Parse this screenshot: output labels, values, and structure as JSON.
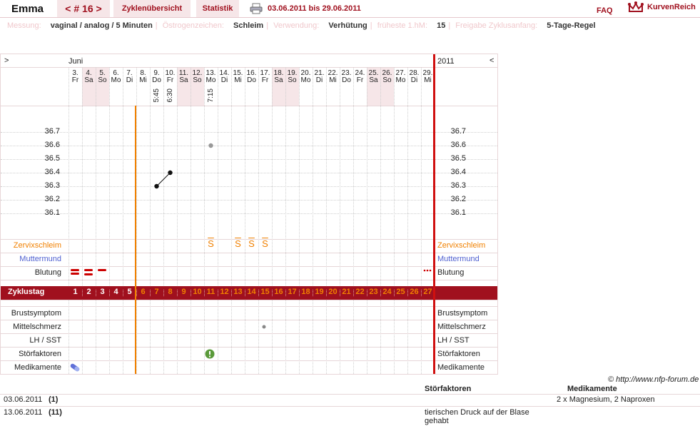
{
  "topbar": {
    "user_name": "Emma",
    "cycle_nav": "< # 16 >",
    "tab_overview": "Zyklenübersicht",
    "tab_stats": "Statistik",
    "date_range": "03.06.2011 bis 29.06.2011",
    "faq": "FAQ",
    "logo_text": "KurvenReich"
  },
  "info": [
    {
      "label": "Messung:",
      "value": "vaginal / analog / 5 Minuten"
    },
    {
      "label": "Östrogenzeichen:",
      "value": "Schleim"
    },
    {
      "label": "Verwendung:",
      "value": "Verhütung"
    },
    {
      "label": "früheste 1.hM:",
      "value": "15"
    },
    {
      "label": "Freigabe Zyklusanfang:",
      "value": "5-Tage-Regel"
    }
  ],
  "chart": {
    "left_arrow": ">",
    "right_arrow": "<",
    "month": "Juni",
    "year": "2011",
    "days": [
      {
        "d": "3.",
        "w": "Fr",
        "we": false
      },
      {
        "d": "4.",
        "w": "Sa",
        "we": true
      },
      {
        "d": "5.",
        "w": "So",
        "we": true
      },
      {
        "d": "6.",
        "w": "Mo",
        "we": false
      },
      {
        "d": "7.",
        "w": "Di",
        "we": false
      },
      {
        "d": "8.",
        "w": "Mi",
        "we": false
      },
      {
        "d": "9.",
        "w": "Do",
        "we": false
      },
      {
        "d": "10.",
        "w": "Fr",
        "we": false
      },
      {
        "d": "11.",
        "w": "Sa",
        "we": true
      },
      {
        "d": "12.",
        "w": "So",
        "we": true
      },
      {
        "d": "13.",
        "w": "Mo",
        "we": false
      },
      {
        "d": "14.",
        "w": "Di",
        "we": false
      },
      {
        "d": "15.",
        "w": "Mi",
        "we": false
      },
      {
        "d": "16.",
        "w": "Do",
        "we": false
      },
      {
        "d": "17.",
        "w": "Fr",
        "we": false
      },
      {
        "d": "18.",
        "w": "Sa",
        "we": true
      },
      {
        "d": "19.",
        "w": "So",
        "we": true
      },
      {
        "d": "20.",
        "w": "Mo",
        "we": false
      },
      {
        "d": "21.",
        "w": "Di",
        "we": false
      },
      {
        "d": "22.",
        "w": "Mi",
        "we": false
      },
      {
        "d": "23.",
        "w": "Do",
        "we": false
      },
      {
        "d": "24.",
        "w": "Fr",
        "we": false
      },
      {
        "d": "25.",
        "w": "Sa",
        "we": true
      },
      {
        "d": "26.",
        "w": "So",
        "we": true
      },
      {
        "d": "27.",
        "w": "Mo",
        "we": false
      },
      {
        "d": "28.",
        "w": "Di",
        "we": false
      },
      {
        "d": "29.",
        "w": "Mi",
        "we": false
      }
    ],
    "times": [
      {
        "day_index": 6,
        "time": "5:45"
      },
      {
        "day_index": 7,
        "time": "6:30"
      },
      {
        "day_index": 10,
        "time": "7:15"
      }
    ],
    "y_ticks": [
      "36.7",
      "36.6",
      "36.5",
      "36.4",
      "36.3",
      "36.2",
      "36.1"
    ],
    "temps": [
      {
        "day_index": 6,
        "value": 36.3,
        "excluded": false
      },
      {
        "day_index": 7,
        "value": 36.4,
        "excluded": false
      },
      {
        "day_index": 10,
        "value": 36.6,
        "excluded": true
      }
    ],
    "rows": {
      "zervix": "Zervixschleim",
      "muttermund": "Muttermund",
      "blutung": "Blutung",
      "zyklustag": "Zyklustag",
      "brust": "Brustsymptom",
      "mittel": "Mittelschmerz",
      "lh": "LH / SST",
      "stoer": "Störfaktoren",
      "medi": "Medikamente"
    },
    "zervix_symbol": "S",
    "zervix_days": [
      10,
      12,
      13,
      14
    ],
    "cycle_days": [
      "1",
      "2",
      "3",
      "4",
      "5",
      "6",
      "7",
      "8",
      "9",
      "10",
      "11",
      "12",
      "13",
      "14",
      "15",
      "16",
      "17",
      "18",
      "19",
      "20",
      "21",
      "22",
      "23",
      "24",
      "25",
      "26",
      "27"
    ],
    "infertile_until": 5,
    "colors": {
      "brand": "#a0101e",
      "orange": "#f08000",
      "blue": "#5060d0",
      "weekend": "#f6e6e8"
    }
  },
  "copyright": "© http://www.nfp-forum.de",
  "notes": {
    "col_stoer": "Störfaktoren",
    "col_medi": "Medikamente",
    "rows": [
      {
        "date": "03.06.2011",
        "day": "(1)",
        "stoer": "",
        "medi": "2 x Magnesium, 2 Naproxen"
      },
      {
        "date": "13.06.2011",
        "day": "(11)",
        "stoer": "tierischen Druck auf der Blase gehabt",
        "medi": ""
      }
    ]
  }
}
